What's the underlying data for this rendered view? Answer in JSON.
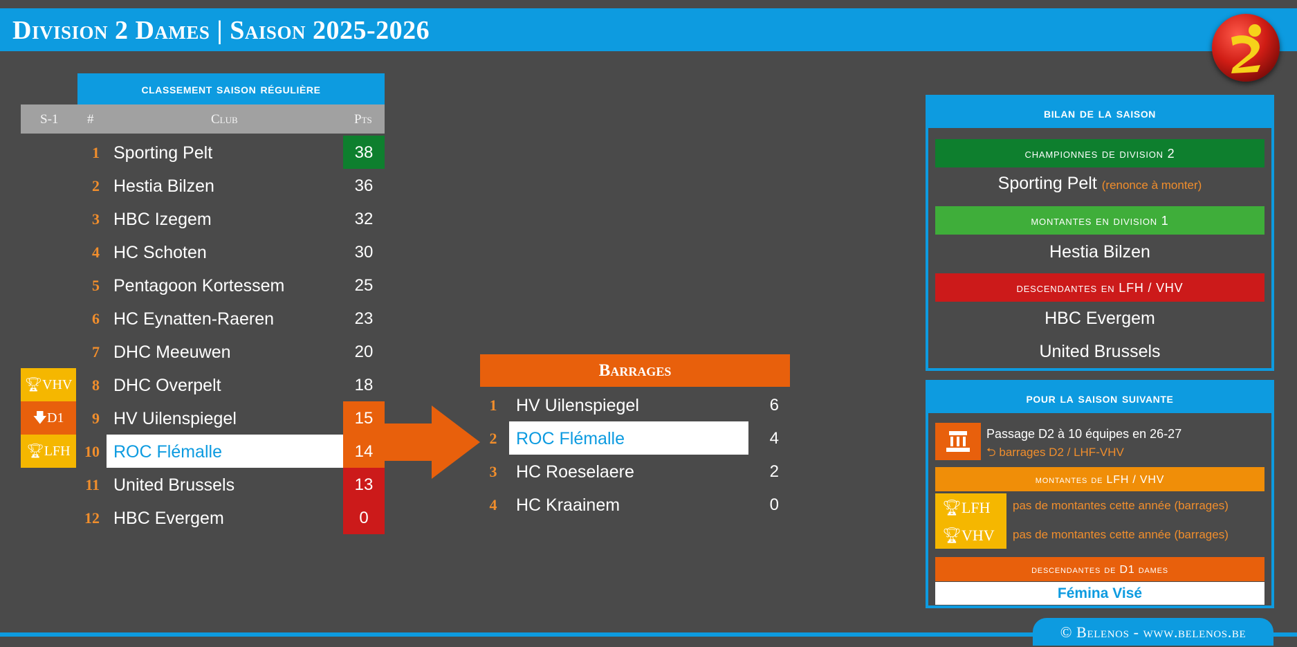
{
  "header": {
    "title": "Division 2 Dames | Saison 2025-2026"
  },
  "ranking": {
    "title": "classement saison régulière",
    "columns": {
      "prev": "S-1",
      "rank": "#",
      "club": "Club",
      "pts": "Pts"
    },
    "rows": [
      {
        "rank": "1",
        "club": "Sporting Pelt",
        "pts": "38",
        "badge": "",
        "pts_color": "#0e7f2e"
      },
      {
        "rank": "2",
        "club": "Hestia Bilzen",
        "pts": "36",
        "badge": "",
        "pts_color": ""
      },
      {
        "rank": "3",
        "club": "HBC Izegem",
        "pts": "32",
        "badge": "",
        "pts_color": ""
      },
      {
        "rank": "4",
        "club": "HC Schoten",
        "pts": "30",
        "badge": "",
        "pts_color": ""
      },
      {
        "rank": "5",
        "club": "Pentagoon Kortessem",
        "pts": "25",
        "badge": "",
        "pts_color": ""
      },
      {
        "rank": "6",
        "club": "HC Eynatten-Raeren",
        "pts": "23",
        "badge": "",
        "pts_color": ""
      },
      {
        "rank": "7",
        "club": "DHC Meeuwen",
        "pts": "20",
        "badge": "",
        "pts_color": ""
      },
      {
        "rank": "8",
        "club": "DHC Overpelt",
        "pts": "18",
        "badge": "VHV",
        "badge_icon": "trophy-icon",
        "badge_color": "#f5b700",
        "pts_color": ""
      },
      {
        "rank": "9",
        "club": "HV Uilenspiegel",
        "pts": "15",
        "badge": "D1",
        "badge_icon": "arrow-down-icon",
        "badge_color": "#e8600c",
        "pts_color": "#e8600c"
      },
      {
        "rank": "10",
        "club": "ROC Flémalle",
        "pts": "14",
        "badge": "LFH",
        "badge_icon": "trophy-icon",
        "badge_color": "#f5b700",
        "pts_color": "#e8600c",
        "highlight": true
      },
      {
        "rank": "11",
        "club": "United Brussels",
        "pts": "13",
        "badge": "",
        "pts_color": "#cc1a1a"
      },
      {
        "rank": "12",
        "club": "HBC Evergem",
        "pts": "0",
        "badge": "",
        "pts_color": "#cc1a1a"
      }
    ]
  },
  "barrages": {
    "title": "Barrages",
    "rows": [
      {
        "rank": "1",
        "club": "HV Uilenspiegel",
        "pts": "6"
      },
      {
        "rank": "2",
        "club": "ROC Flémalle",
        "pts": "4",
        "highlight": true
      },
      {
        "rank": "3",
        "club": "HC Roeselaere",
        "pts": "2"
      },
      {
        "rank": "4",
        "club": "HC Kraainem",
        "pts": "0"
      }
    ]
  },
  "bilan": {
    "title": "bilan de la saison",
    "champions_label": "championnes de division 2",
    "champion": "Sporting Pelt",
    "champion_note": "(renonce à monter)",
    "promoted_label": "montantes en division 1",
    "promoted": [
      "Hestia Bilzen"
    ],
    "relegated_label": "descendantes en LFH / VHV",
    "relegated": [
      "HBC Evergem",
      "United Brussels"
    ],
    "colors": {
      "champions": "#0e7f2e",
      "promoted": "#3fae3a",
      "relegated": "#cc1a1a"
    }
  },
  "next_season": {
    "title": "pour la saison suivante",
    "info_line1": "Passage D2 à 10 équipes en 26-27",
    "info_line2": "barrages D2 / LHF-VHV",
    "info_icon": "podium-icon",
    "info_link_icon": "redo-icon",
    "lfh_vhv_label": "montantes de LFH / VHV",
    "lfh_label": "LFH",
    "vhv_label": "VHV",
    "lfh_text": "pas de montantes cette année (barrages)",
    "vhv_text": "pas de montantes cette année (barrages)",
    "d1_label": "descendantes de D1 dames",
    "d1_team": "Fémina Visé"
  },
  "footer": {
    "credit": "© Belenos - www.belenos.be"
  }
}
